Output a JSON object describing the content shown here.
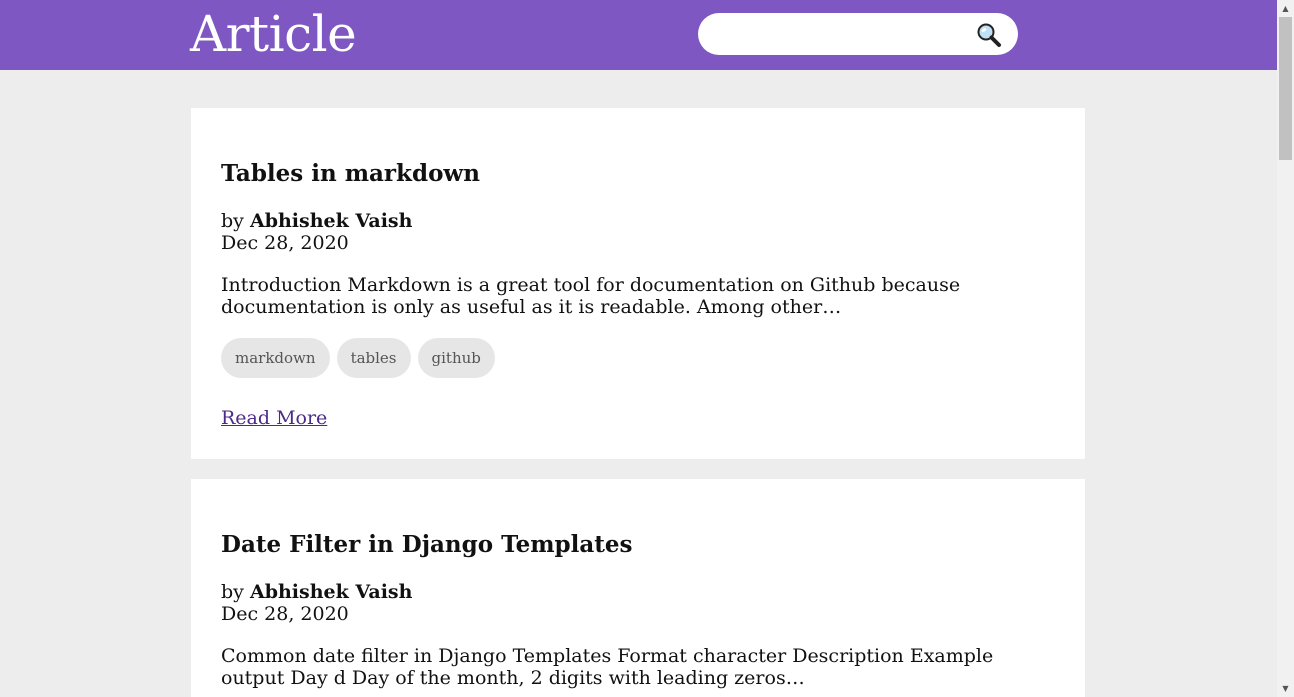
{
  "header": {
    "brand": "Article",
    "search": {
      "value": "",
      "placeholder": ""
    },
    "search_icon": "magnifier-icon"
  },
  "articles": [
    {
      "title": "Tables in markdown",
      "by_prefix": "by",
      "author": "Abhishek Vaish",
      "date": "Dec 28, 2020",
      "excerpt": "Introduction Markdown is a great tool for documentation on Github because documentation is only as useful as it is readable. Among other…",
      "tags": [
        "markdown",
        "tables",
        "github"
      ],
      "read_more": "Read More"
    },
    {
      "title": "Date Filter in Django Templates",
      "by_prefix": "by",
      "author": "Abhishek Vaish",
      "date": "Dec 28, 2020",
      "excerpt": "Common date filter in Django Templates Format character Description Example output Day d Day of the month, 2 digits with leading zeros…"
    }
  ],
  "colors": {
    "header_bg": "#7e57c2",
    "page_bg": "#ededed",
    "link": "#4b2a8a"
  }
}
